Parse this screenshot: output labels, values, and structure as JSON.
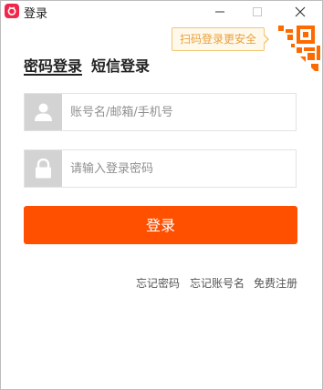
{
  "window": {
    "title": "登录"
  },
  "qr": {
    "tip": "扫码登录更安全"
  },
  "tabs": [
    {
      "label": "密码登录",
      "active": true
    },
    {
      "label": "短信登录",
      "active": false
    }
  ],
  "fields": {
    "username": {
      "placeholder": "账号名/邮箱/手机号",
      "value": ""
    },
    "password": {
      "placeholder": "请输入登录密码",
      "value": ""
    }
  },
  "login_button": {
    "label": "登录"
  },
  "links": {
    "forgot_password": "忘记密码",
    "forgot_account": "忘记账号名",
    "register": "免费注册"
  },
  "colors": {
    "accent": "#ff5000",
    "app_icon": "#f0264a",
    "qr_tip_text": "#e8a03a",
    "qr_tip_border": "#f2c572",
    "icon_bg": "#d3d3d3"
  },
  "icons": {
    "app": "taobao-icon",
    "minimize": "minimize-icon",
    "maximize": "maximize-icon",
    "close": "close-icon",
    "qr": "qr-code-icon",
    "user": "user-icon",
    "lock": "lock-icon"
  }
}
